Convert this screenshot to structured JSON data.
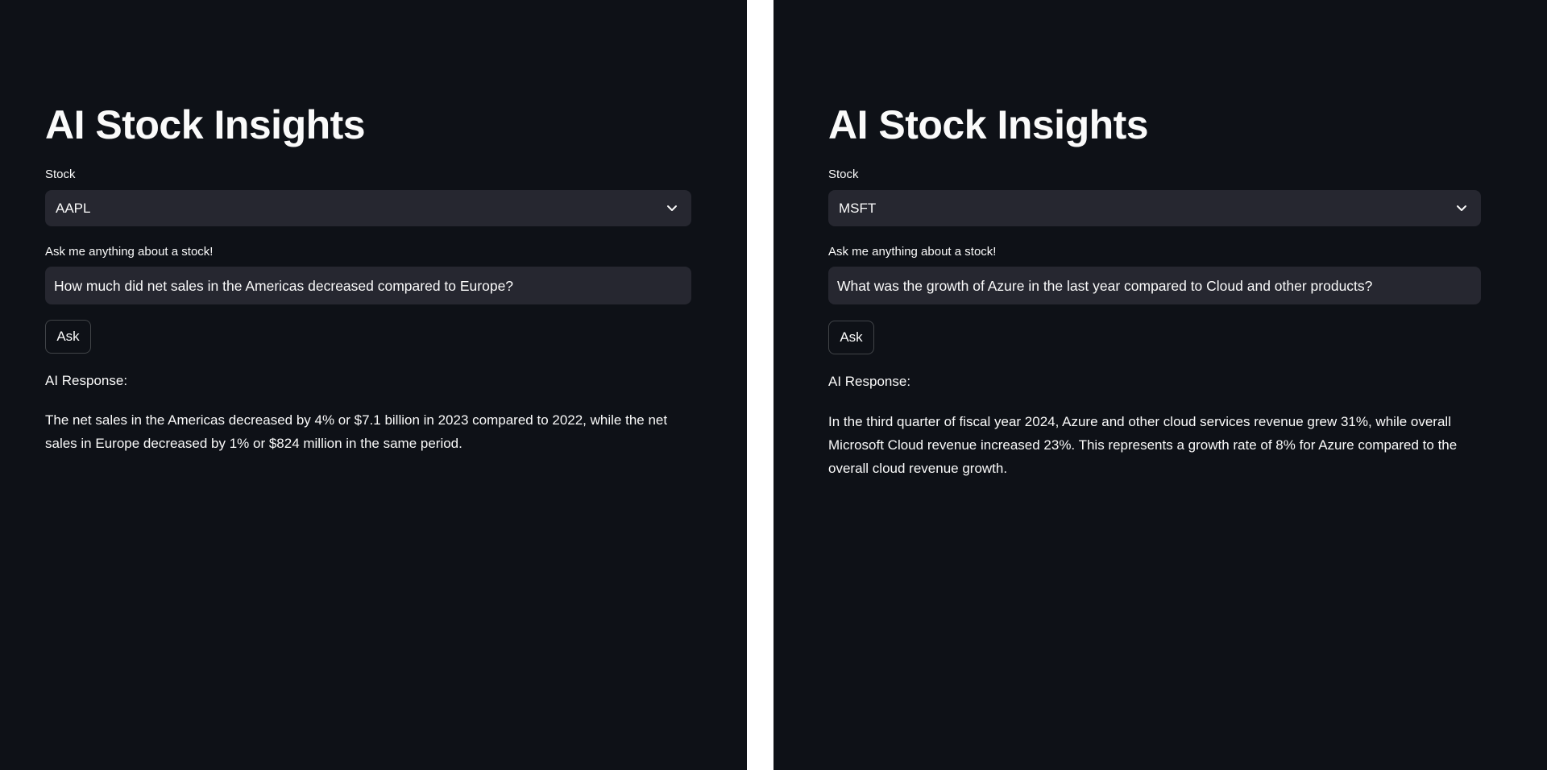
{
  "panels": [
    {
      "title": "AI Stock Insights",
      "stock_label": "Stock",
      "stock_value": "AAPL",
      "question_label": "Ask me anything about a stock!",
      "question_value": "How much did net sales in the Americas decreased compared to Europe?",
      "ask_label": "Ask",
      "response_label": "AI Response:",
      "response_text": "The net sales in the Americas decreased by 4% or $7.1 billion in 2023 compared to 2022, while the net sales in Europe decreased by 1% or $824 million in the same period."
    },
    {
      "title": "AI Stock Insights",
      "stock_label": "Stock",
      "stock_value": "MSFT",
      "question_label": "Ask me anything about a stock!",
      "question_value": "What was the growth of Azure in the last year compared to Cloud and other products?",
      "ask_label": "Ask",
      "response_label": "AI Response:",
      "response_text": "In the third quarter of fiscal year 2024, Azure and other cloud services revenue grew 31%, while overall Microsoft Cloud revenue increased 23%. This represents a growth rate of 8% for Azure compared to the overall cloud revenue growth."
    }
  ],
  "icons": {
    "dropdown": "chevron-down-icon"
  },
  "colors": {
    "background": "#0e1117",
    "widget": "#262730",
    "text": "#fafafa",
    "divider": "#ffffff"
  }
}
